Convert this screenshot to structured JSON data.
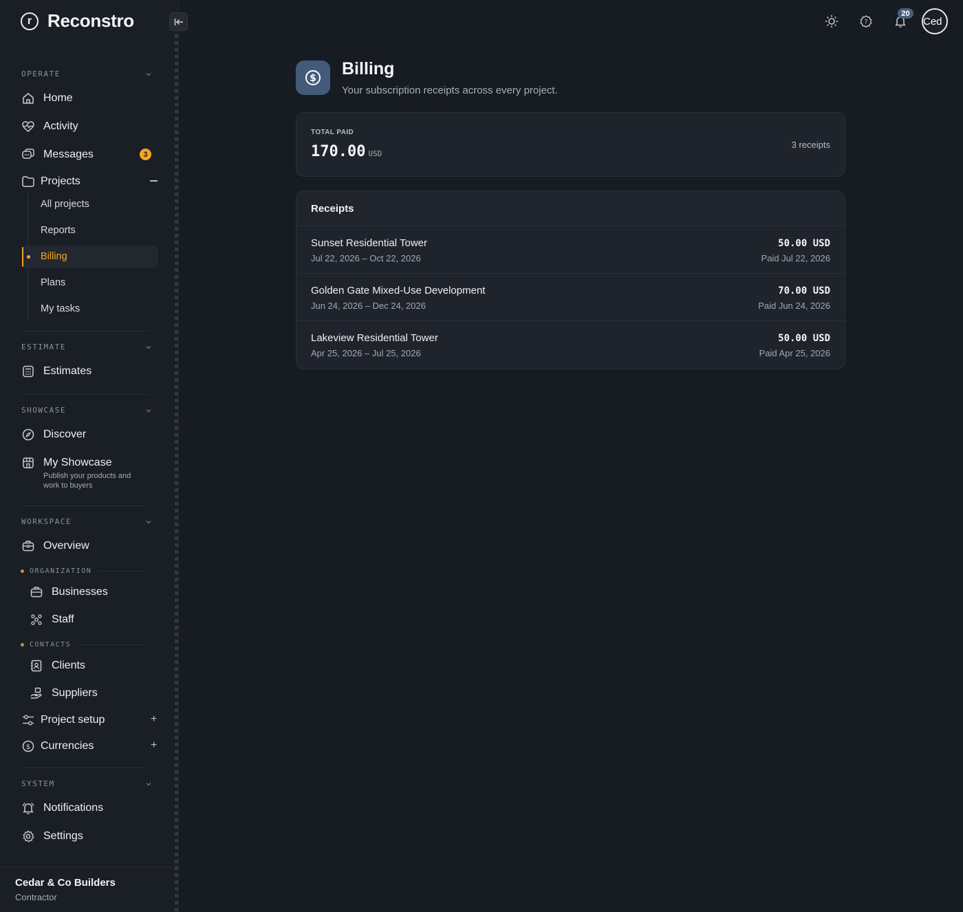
{
  "app": {
    "name": "Reconstro",
    "logo_letter": "r"
  },
  "sidebar": {
    "sections": {
      "operate": "OPERATE",
      "estimate": "ESTIMATE",
      "showcase": "SHOWCASE",
      "workspace": "WORKSPACE",
      "system": "SYSTEM"
    },
    "operate": {
      "home": "Home",
      "activity": "Activity",
      "messages": "Messages",
      "messages_badge": "3",
      "projects": "Projects",
      "projects_sub": [
        "All projects",
        "Reports",
        "Billing",
        "Plans",
        "My tasks"
      ],
      "active_sub": "Billing"
    },
    "estimate": {
      "estimates": "Estimates"
    },
    "showcase": {
      "discover": "Discover",
      "my_showcase": "My Showcase",
      "my_showcase_desc": "Publish your products and work to buyers"
    },
    "workspace": {
      "overview": "Overview",
      "organization_label": "ORGANIZATION",
      "businesses": "Businesses",
      "staff": "Staff",
      "contacts_label": "CONTACTS",
      "clients": "Clients",
      "suppliers": "Suppliers",
      "project_setup": "Project setup",
      "currencies": "Currencies"
    },
    "system": {
      "notifications": "Notifications",
      "settings": "Settings"
    },
    "footer": {
      "org_name": "Cedar & Co Builders",
      "org_role": "Contractor"
    }
  },
  "topbar": {
    "notification_count": "20",
    "avatar_text": "Ced"
  },
  "page": {
    "title": "Billing",
    "subtitle": "Your subscription receipts across every project."
  },
  "summary": {
    "label": "TOTAL PAID",
    "amount": "170.00",
    "currency": "USD",
    "count": "3 receipts"
  },
  "receipts": {
    "heading": "Receipts",
    "items": [
      {
        "project": "Sunset Residential Tower",
        "period": "Jul 22, 2026 – Oct 22, 2026",
        "amount": "50.00 USD",
        "paid": "Paid Jul 22, 2026"
      },
      {
        "project": "Golden Gate Mixed-Use Development",
        "period": "Jun 24, 2026 – Dec 24, 2026",
        "amount": "70.00 USD",
        "paid": "Paid Jun 24, 2026"
      },
      {
        "project": "Lakeview Residential Tower",
        "period": "Apr 25, 2026 – Jul 25, 2026",
        "amount": "50.00 USD",
        "paid": "Paid Apr 25, 2026"
      }
    ]
  },
  "colors": {
    "background": "#171b22",
    "sidebar": "#1a1e25",
    "accent": "#f5a524",
    "page_icon": "#435b7a",
    "card": "#1f232b"
  }
}
